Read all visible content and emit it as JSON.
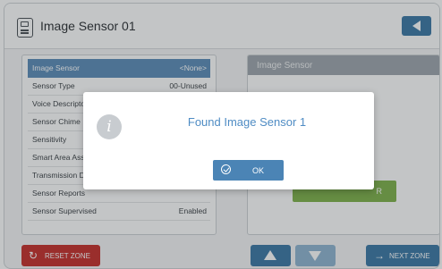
{
  "header": {
    "title": "Image Sensor 01",
    "device_icon": "sensor-device-icon",
    "back_icon": "back-arrow-icon"
  },
  "sensor_list": [
    {
      "label": "Image Sensor",
      "value": "<None>",
      "selected": true
    },
    {
      "label": "Sensor Type",
      "value": "00-Unused"
    },
    {
      "label": "Voice Descriptors",
      "value": ""
    },
    {
      "label": "Sensor Chime",
      "value": ""
    },
    {
      "label": "Sensitivity",
      "value": ""
    },
    {
      "label": "Smart Area Assignment",
      "value": ""
    },
    {
      "label": "Transmission Delay",
      "value": ""
    },
    {
      "label": "Sensor Reports",
      "value": ""
    },
    {
      "label": "Sensor Supervised",
      "value": "Enabled"
    }
  ],
  "right_panel": {
    "title": "Image Sensor",
    "green_button_label": "R"
  },
  "footer": {
    "reset_label": "RESET ZONE",
    "next_label": "NEXT ZONE",
    "up_icon": "up-arrow-icon",
    "down_icon": "down-arrow-icon"
  },
  "modal": {
    "message": "Found Image Sensor 1",
    "ok_label": "OK",
    "icon": "info-icon"
  },
  "colors": {
    "accent": "#3b78a6",
    "selected_row": "#5c8db9",
    "danger": "#c62f2a",
    "success": "#7fb24a",
    "modal_text": "#4f8cc4"
  }
}
